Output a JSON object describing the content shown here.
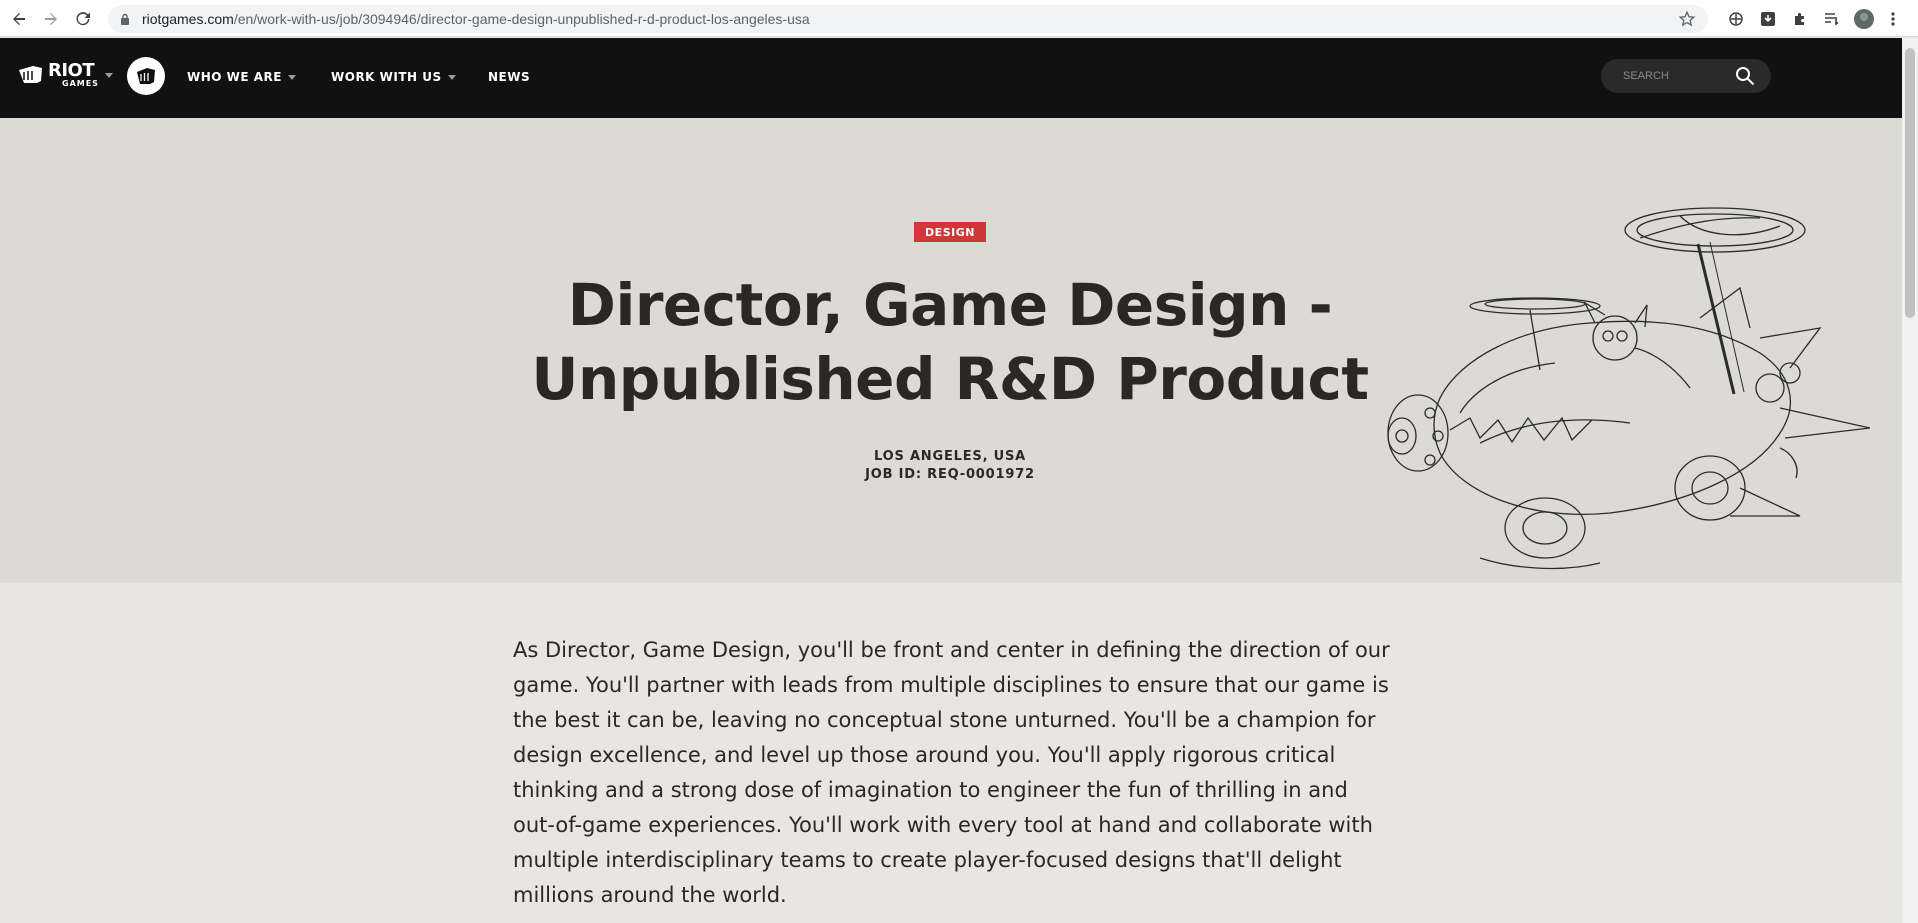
{
  "browser": {
    "url_host": "riotgames.com",
    "url_path": "/en/work-with-us/job/3094946/director-game-design-unpublished-r-d-product-los-angeles-usa"
  },
  "site_nav": {
    "logo_line1": "RIOT",
    "logo_line2": "GAMES",
    "items": [
      {
        "label": "WHO WE ARE"
      },
      {
        "label": "WORK WITH US"
      },
      {
        "label": "NEWS"
      }
    ],
    "search_placeholder": "SEARCH"
  },
  "job": {
    "category": "DESIGN",
    "title_line1": "Director, Game Design -",
    "title_line2": "Unpublished R&D Product",
    "location": "LOS ANGELES, USA",
    "job_id": "JOB ID: REQ-0001972"
  },
  "description": "As Director, Game Design, you'll be front and center in defining the direction of our game. You'll partner with leads from multiple disciplines to ensure that our game is the best it can be, leaving no conceptual stone unturned. You'll be a champion for design excellence, and level up those around you. You'll apply rigorous critical thinking and a strong dose of imagination to engineer the fun of thrilling in and out-of-game experiences. You'll work with every tool at hand and collaborate with multiple interdisciplinary teams to create player-focused designs that'll delight millions around the world.",
  "colors": {
    "nav_bg": "#111111",
    "hero_bg": "#dcdad5",
    "page_bg": "#e8e6e1",
    "tag_red": "#d13639",
    "text_dark": "#2a2825"
  }
}
